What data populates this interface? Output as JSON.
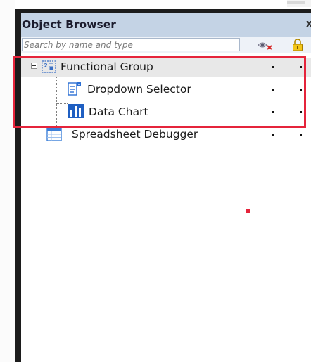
{
  "panel": {
    "title": "Object Browser",
    "close_label": "x"
  },
  "search": {
    "placeholder": "Search by name and type",
    "value": ""
  },
  "toolbar_icons": [
    "visibility-eye-icon",
    "lock-icon"
  ],
  "tree": {
    "items": [
      {
        "label": "Functional Group",
        "icon": "group-icon",
        "level": 0,
        "expanded": true,
        "selected": true
      },
      {
        "label": "Dropdown Selector",
        "icon": "dropdown-selector-icon",
        "level": 1
      },
      {
        "label": "Data Chart",
        "icon": "bar-chart-icon",
        "level": 1
      },
      {
        "label": "Spreadsheet Debugger",
        "icon": "spreadsheet-icon",
        "level": 0
      }
    ]
  },
  "colors": {
    "title_bar": "#c4d3e5",
    "highlight": "#e5243b",
    "selected_row": "#e8e8e8"
  }
}
